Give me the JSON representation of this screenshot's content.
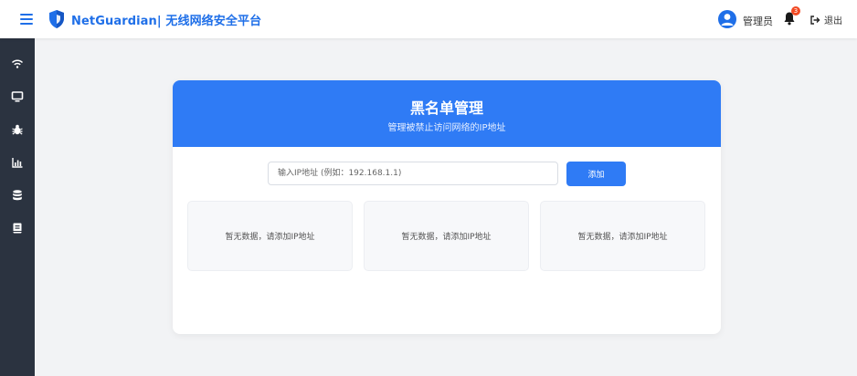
{
  "header": {
    "brand_title": "NetGuardian| 无线网络安全平台",
    "user_label": "管理员",
    "notification_count": "3",
    "logout_label": "退出"
  },
  "sidebar": {
    "items": [
      {
        "icon": "wifi-icon"
      },
      {
        "icon": "monitor-icon"
      },
      {
        "icon": "bug-icon"
      },
      {
        "icon": "chart-icon"
      },
      {
        "icon": "database-icon"
      },
      {
        "icon": "book-icon"
      }
    ]
  },
  "blacklist": {
    "title": "黑名单管理",
    "subtitle": "管理被禁止访问网络的IP地址",
    "input_placeholder": "输入IP地址 (例如：192.168.1.1)",
    "add_label": "添加",
    "slots": [
      {
        "text": "暂无数据，请添加IP地址"
      },
      {
        "text": "暂无数据，请添加IP地址"
      },
      {
        "text": "暂无数据，请添加IP地址"
      }
    ]
  },
  "colors": {
    "brand": "#1f6fe8",
    "header_blue": "#2f7bf5",
    "sidebar_bg": "#2b3340",
    "badge": "#f24a24"
  }
}
